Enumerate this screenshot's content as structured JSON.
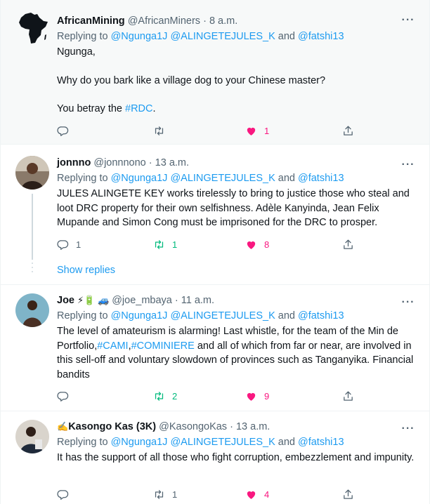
{
  "tweets": [
    {
      "name": "AfricanMining",
      "handle": "@AfricanMiners",
      "time": "8 a.m.",
      "replying_prefix": "Replying to ",
      "replying_to": [
        "@Ngunga1J",
        "@ALINGETEJULES_K",
        "@fatshi13"
      ],
      "and_word": " and ",
      "lines": [
        "Ngunga,",
        "Why do you bark like a village dog to your Chinese master?",
        "You betray the "
      ],
      "hashtag": "#RDC",
      "after_hashtag": ".",
      "replies": "",
      "retweets": "",
      "likes": "1"
    },
    {
      "name": "jonnno",
      "handle": "@jonnnono",
      "time": "13 a.m.",
      "replying_prefix": "Replying to ",
      "replying_to": [
        "@Ngunga1J",
        "@ALINGETEJULES_K",
        "@fatshi13"
      ],
      "and_word": " and ",
      "text": "JULES ALINGETE KEY works tirelessly to bring to justice those who steal and loot DRC property for their own selfishness. Adèle Kanyinda, Jean Felix Mupande and Simon Cong must be imprisoned for the DRC to prosper.",
      "replies": "1",
      "retweets": "1",
      "likes": "8"
    },
    {
      "name": "Joe",
      "emoji": "⚡🔋 🚙",
      "handle": "@joe_mbaya",
      "time": "11 a.m.",
      "replying_prefix": "Replying to ",
      "replying_to": [
        "@Ngunga1J",
        "@ALINGETEJULES_K",
        "@fatshi13"
      ],
      "and_word": " and ",
      "text_before": "The level of amateurism is alarming! Last whistle, for the team of the Min de Portfolio,",
      "hashtag1": "#CAMI",
      "comma": ",",
      "hashtag2": "#COMINIERE",
      "text_after": " and all of which from far or near, are involved in this sell-off and voluntary slowdown of provinces such as Tanganyika. Financial bandits",
      "replies": "",
      "retweets": "2",
      "likes": "9"
    },
    {
      "emoji": "✍️",
      "name": "Kasongo Kas (3K)",
      "handle": "@KasongoKas",
      "time": "13 a.m.",
      "replying_prefix": "Replying to ",
      "replying_to": [
        "@Ngunga1J",
        "@ALINGETEJULES_K",
        "@fatshi13"
      ],
      "and_word": " and ",
      "text": "It has the support of all those who fight corruption, embezzlement and impunity.",
      "replies": "",
      "retweets": "1",
      "likes": "4"
    }
  ],
  "show_replies": "Show replies",
  "more_glyph": "···",
  "separator": "·",
  "colors": {
    "link": "#1d9bf0",
    "retweet": "#00ba7c",
    "like": "#f91880",
    "muted": "#536471",
    "highlight_bg": "#f7f9f9"
  },
  "icons": [
    "reply-icon",
    "retweet-icon",
    "heart-filled-icon",
    "share-icon",
    "more-icon"
  ]
}
